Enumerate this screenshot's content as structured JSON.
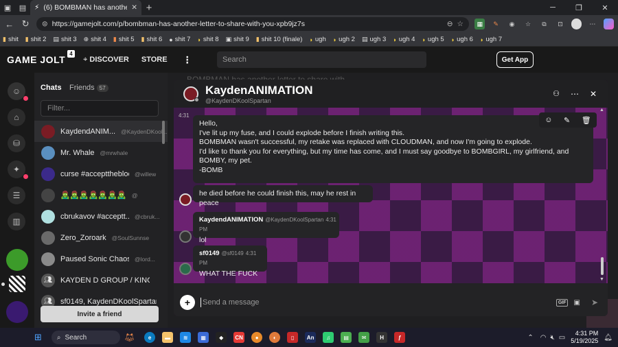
{
  "browser": {
    "tab_title": "(6) BOMBMAN has another letter",
    "url": "https://gamejolt.com/p/bombman-has-another-letter-to-share-with-you-xpb9jz7s",
    "bookmarks": [
      "shit",
      "shit 2",
      "shit 3",
      "shit 4",
      "shit 5",
      "shit 6",
      "shit 7",
      "shit 8",
      "shit 9",
      "shit 10 (finale)",
      "ugh",
      "ugh 2",
      "ugh 3",
      "ugh 4",
      "ugh 5",
      "ugh 6",
      "ugh 7"
    ]
  },
  "header": {
    "logo": "GAME JOLT",
    "logo_badge": "4",
    "discover": "DISCOVER",
    "store": "STORE",
    "search_placeholder": "Search",
    "get_app": "Get App"
  },
  "chats": {
    "tab_chats": "Chats",
    "tab_friends": "Friends",
    "friends_count": "57",
    "filter_placeholder": "Filter...",
    "items": [
      {
        "name": "KaydendANIM...",
        "handle": "@KaydenDKool..."
      },
      {
        "name": "Mr. Whale",
        "handle": "@mrwhale"
      },
      {
        "name": "curse #accepttheblock",
        "handle": "@willew"
      },
      {
        "name": "🧟‍♂️🧟‍♂️🧟‍♂️🧟‍♂️🧟‍♂️🧟‍♂️🧟‍♂️",
        "handle": "@"
      },
      {
        "name": "cbrukavov #acceptt...",
        "handle": "@cbruk..."
      },
      {
        "name": "Zero_Zoroark",
        "handle": "@SoulSunnse"
      },
      {
        "name": "Paused Sonic Chaos ...",
        "handle": "@lord..."
      },
      {
        "name": "KAYDEN D GROUP / KING P...",
        "handle": ""
      },
      {
        "name": "sf0149, KaydenDKoolSpartan",
        "handle": ""
      }
    ],
    "invite_label": "Invite a friend"
  },
  "chat_window": {
    "title": "KaydenANIMATION",
    "handle": "@KaydenDKoolSpartan",
    "top_text": "BOMBMAN has another letter to share with",
    "messages": [
      {
        "time": "4:31",
        "lines": [
          "Hello,",
          "I've lit up my fuse, and I could explode before I finish writing this.",
          "BOMBMAN wasn't successful, my retake was replaced with CLOUDMAN, and now I'm going to explode.",
          "I'd like to thank you for everything, but my time has come, and I must say goodbye to BOMBGIRL, my girlfriend, and BOMBY, my pet.",
          "-BOMB"
        ]
      },
      {
        "text": "he died before he could finish this, may he rest in peace"
      },
      {
        "name": "KaydendANIMATION",
        "handle": "@KaydenDKoolSpartan",
        "time": "4:31 PM",
        "text": "lol"
      },
      {
        "name": "sf0149",
        "handle": "@sf0149",
        "time": "4:31 PM",
        "text": "WHAT THE FUCK"
      }
    ],
    "composer_placeholder": "Send a message",
    "gif_label": "GIF"
  },
  "taskbar": {
    "search": "Search",
    "time": "4:31 PM",
    "date": "5/19/2025"
  },
  "colors": {
    "accent": "#ccff00",
    "chat_bg": "#3a1b45",
    "pattern": "#962896",
    "notification": "#ff3f6c"
  }
}
